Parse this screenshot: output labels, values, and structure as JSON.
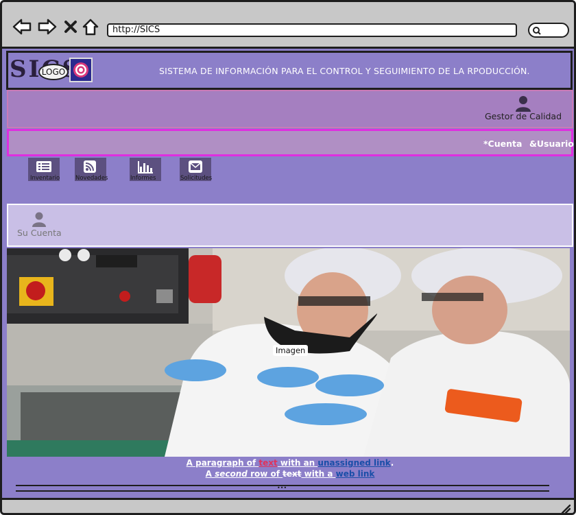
{
  "browser": {
    "url": "http://SICS",
    "icons": [
      "back-arrow-icon",
      "forward-arrow-icon",
      "close-x-icon",
      "home-icon",
      "search-icon"
    ]
  },
  "header": {
    "logo_text": "SICS",
    "logo_badge": "LOGO",
    "title": "SISTEMA DE INFORMACIÓN PARA EL CONTROL Y SEGUIMIENTO DE LA RPODUCCIÓN."
  },
  "user": {
    "role": "Gestor de Calidad"
  },
  "menu": {
    "items": [
      {
        "label": "*Cuenta"
      },
      {
        "label": "&Usuario"
      }
    ]
  },
  "tools": [
    {
      "label": "Inventario",
      "icon": "list-icon"
    },
    {
      "label": "Novedades",
      "icon": "rss-icon"
    },
    {
      "label": "Informes",
      "icon": "bar-chart-icon"
    },
    {
      "label": "Solicitudes",
      "icon": "mail-icon"
    }
  ],
  "account": {
    "label": "Su Cuenta"
  },
  "image": {
    "caption": "Imagen"
  },
  "paragraph1": {
    "p1": "A paragraph of ",
    "p2": "text",
    "p3": " with an ",
    "p4": "unassigned link",
    "p5": "."
  },
  "paragraph2": {
    "p1": "A ",
    "p2": "second",
    "p3": " row of ",
    "p4": "text",
    "p5": " with a ",
    "p6": "web link"
  },
  "footer": {
    "dots": "•••"
  },
  "colors": {
    "page_bg": "#8c7fc9",
    "menu_border": "#e02ee0",
    "link": "#1a4ea8",
    "text_red": "#e0325a"
  }
}
